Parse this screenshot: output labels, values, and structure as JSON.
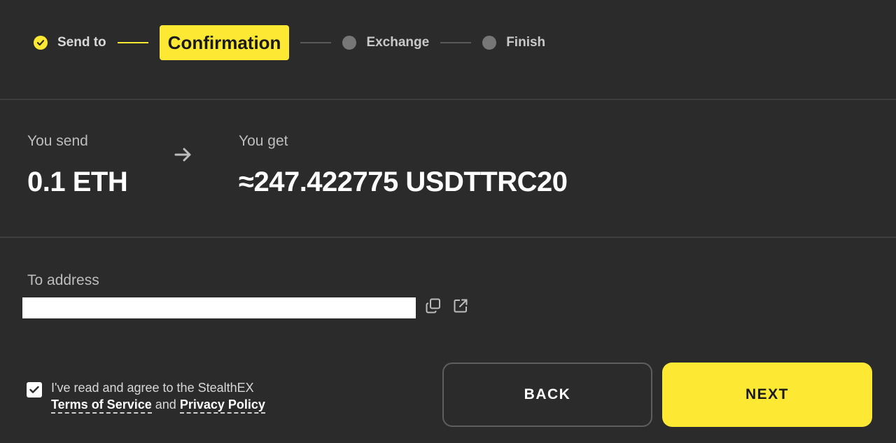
{
  "stepper": {
    "steps": [
      {
        "label": "Send to",
        "state": "done"
      },
      {
        "label": "Confirmation",
        "state": "active"
      },
      {
        "label": "Exchange",
        "state": "pending"
      },
      {
        "label": "Finish",
        "state": "pending"
      }
    ]
  },
  "summary": {
    "send_label": "You send",
    "send_value": "0.1 ETH",
    "get_label": "You get",
    "get_value": "≈247.422775 USDTTRC20"
  },
  "address": {
    "label": "To address",
    "value": ""
  },
  "agreement": {
    "text_before": "I've read and agree to the StealthEX",
    "terms_link": "Terms of Service",
    "conjunction": "and",
    "privacy_link": "Privacy Policy",
    "checked": true
  },
  "buttons": {
    "back_label": "BACK",
    "next_label": "NEXT"
  },
  "colors": {
    "accent": "#fde934",
    "background": "#2b2b2b"
  }
}
